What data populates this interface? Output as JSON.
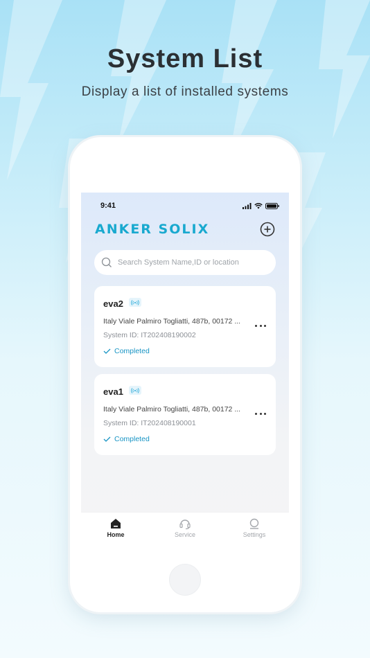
{
  "promo": {
    "title": "System List",
    "subtitle": "Display a list of installed systems"
  },
  "status_bar": {
    "time": "9:41"
  },
  "header": {
    "logo": "ANKER SOLIX"
  },
  "search": {
    "placeholder": "Search System Name,ID or location",
    "value": ""
  },
  "systems": [
    {
      "name": "eva2",
      "address": "Italy Viale Palmiro Togliatti, 487b, 00172 ...",
      "system_id": "System ID: IT202408190002",
      "status": "Completed"
    },
    {
      "name": "eva1",
      "address": "Italy Viale Palmiro Togliatti, 487b, 00172 ...",
      "system_id": "System ID: IT202408190001",
      "status": "Completed"
    }
  ],
  "tabs": [
    {
      "label": "Home",
      "icon": "home-icon",
      "active": true
    },
    {
      "label": "Service",
      "icon": "headset-icon",
      "active": false
    },
    {
      "label": "Settings",
      "icon": "settings-icon",
      "active": false
    }
  ],
  "colors": {
    "brand": "#19a9cf",
    "status_completed": "#1794c4"
  }
}
